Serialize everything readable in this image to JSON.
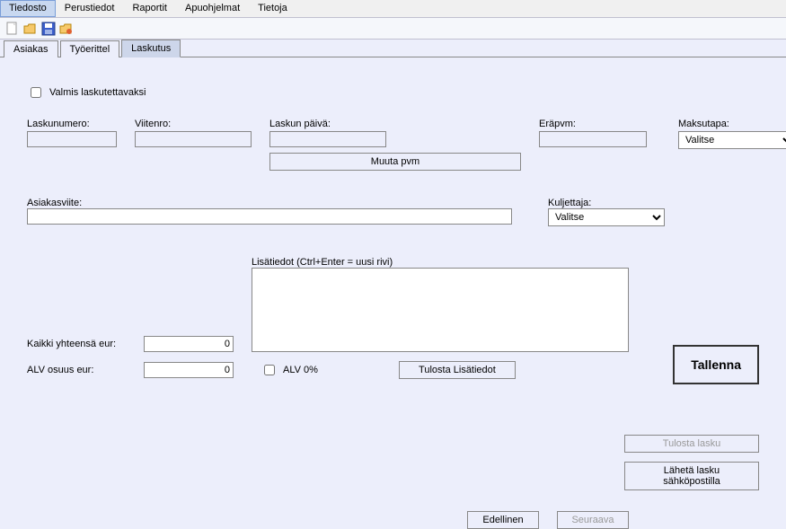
{
  "menu": {
    "tiedosto": "Tiedosto",
    "perustiedot": "Perustiedot",
    "raportit": "Raportit",
    "apuohjelmat": "Apuohjelmat",
    "tietoja": "Tietoja"
  },
  "tabs": {
    "asiakas": "Asiakas",
    "tyoerittel": "Työerittel",
    "laskutus": "Laskutus"
  },
  "form": {
    "valmis_label": "Valmis laskutettavaksi",
    "laskunumero_label": "Laskunumero:",
    "laskunumero_value": "",
    "viitenro_label": "Viitenro:",
    "viitenro_value": "",
    "laskunpaiva_label": "Laskun päivä:",
    "laskunpaiva_value": "",
    "erapvm_label": "Eräpvm:",
    "erapvm_value": "",
    "maksutapa_label": "Maksutapa:",
    "maksutapa_value": "Valitse",
    "muuta_pvm_btn": "Muuta pvm",
    "asiakasviite_label": "Asiakasviite:",
    "asiakasviite_value": "",
    "kuljettaja_label": "Kuljettaja:",
    "kuljettaja_value": "Valitse",
    "lisatiedot_label": "Lisätiedot (Ctrl+Enter = uusi rivi)",
    "lisatiedot_value": "",
    "kaikki_label": "Kaikki yhteensä eur:",
    "kaikki_value": "0",
    "alv_osuus_label": "ALV osuus eur:",
    "alv_osuus_value": "0",
    "alv0_label": "ALV 0%",
    "tulosta_lisa_btn": "Tulosta Lisätiedot",
    "tallenna_btn": "Tallenna",
    "tulosta_lasku_btn": "Tulosta lasku",
    "laheta_btn": "Lähetä lasku sähköpostilla",
    "edellinen_btn": "Edellinen",
    "seuraava_btn": "Seuraava"
  }
}
